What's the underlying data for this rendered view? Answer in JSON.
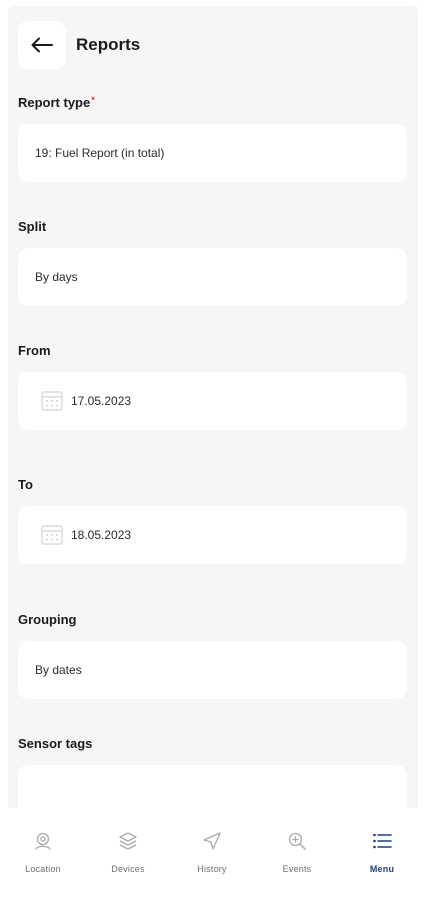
{
  "header": {
    "title": "Reports"
  },
  "fields": {
    "report_type": {
      "label": "Report type",
      "required_mark": "*",
      "value": "19: Fuel Report (in total)"
    },
    "split": {
      "label": "Split",
      "value": "By days"
    },
    "from": {
      "label": "From",
      "value": "17.05.2023"
    },
    "to": {
      "label": "To",
      "value": "18.05.2023"
    },
    "grouping": {
      "label": "Grouping",
      "value": "By dates"
    },
    "sensor_tags": {
      "label": "Sensor tags",
      "value": ""
    }
  },
  "tabbar": {
    "active": "Menu",
    "tabs": [
      {
        "label": "Location",
        "icon": "location-pin-icon"
      },
      {
        "label": "Devices",
        "icon": "layers-icon"
      },
      {
        "label": "History",
        "icon": "navigation-arrow-icon"
      },
      {
        "label": "Events",
        "icon": "zoom-search-icon"
      },
      {
        "label": "Menu",
        "icon": "menu-list-icon"
      }
    ]
  },
  "colors": {
    "background": "#f6f6f7",
    "card": "#ffffff",
    "active_tab": "#1f3f78",
    "inactive_tab": "#6e6e73"
  }
}
